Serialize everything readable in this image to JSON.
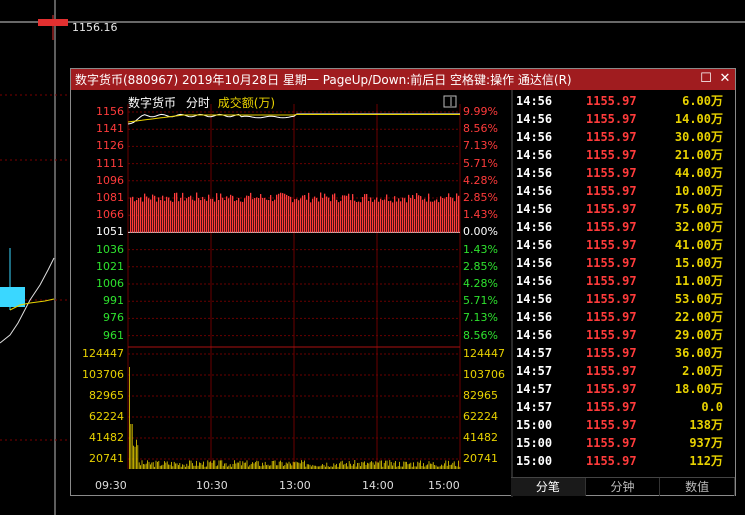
{
  "background_price": "1156.16",
  "window": {
    "title": "数字货币(880967) 2019年10月28日 星期一 PageUp/Down:前后日 空格键:操作 通达信(R)",
    "minimize_glyph": "☐",
    "close_glyph": "✕"
  },
  "chart_header": {
    "name": "数字货币",
    "mode": "分时",
    "metric": "成交额(万)"
  },
  "price_axis": {
    "left": [
      "1156",
      "1141",
      "1126",
      "1111",
      "1096",
      "1081",
      "1066",
      "1051",
      "1036",
      "1021",
      "1006",
      "991",
      "976",
      "961"
    ],
    "right": [
      "9.99%",
      "8.56%",
      "7.13%",
      "5.71%",
      "4.28%",
      "2.85%",
      "1.43%",
      "0.00%",
      "1.43%",
      "2.85%",
      "4.28%",
      "5.71%",
      "7.13%",
      "8.56%"
    ]
  },
  "volume_axis": {
    "left": [
      "124447",
      "103706",
      "82965",
      "62224",
      "41482",
      "20741"
    ],
    "right": [
      "124447",
      "103706",
      "82965",
      "62224",
      "41482",
      "20741"
    ]
  },
  "time_axis": [
    "09:30",
    "10:30",
    "13:00",
    "14:00",
    "15:00"
  ],
  "ticks": [
    {
      "time": "14:56",
      "price": "1155.97",
      "vol": "6.00",
      "unit": "万"
    },
    {
      "time": "14:56",
      "price": "1155.97",
      "vol": "14.00",
      "unit": "万"
    },
    {
      "time": "14:56",
      "price": "1155.97",
      "vol": "30.00",
      "unit": "万"
    },
    {
      "time": "14:56",
      "price": "1155.97",
      "vol": "21.00",
      "unit": "万"
    },
    {
      "time": "14:56",
      "price": "1155.97",
      "vol": "44.00",
      "unit": "万"
    },
    {
      "time": "14:56",
      "price": "1155.97",
      "vol": "10.00",
      "unit": "万"
    },
    {
      "time": "14:56",
      "price": "1155.97",
      "vol": "75.00",
      "unit": "万"
    },
    {
      "time": "14:56",
      "price": "1155.97",
      "vol": "32.00",
      "unit": "万"
    },
    {
      "time": "14:56",
      "price": "1155.97",
      "vol": "41.00",
      "unit": "万"
    },
    {
      "time": "14:56",
      "price": "1155.97",
      "vol": "15.00",
      "unit": "万"
    },
    {
      "time": "14:56",
      "price": "1155.97",
      "vol": "11.00",
      "unit": "万"
    },
    {
      "time": "14:56",
      "price": "1155.97",
      "vol": "53.00",
      "unit": "万"
    },
    {
      "time": "14:56",
      "price": "1155.97",
      "vol": "22.00",
      "unit": "万"
    },
    {
      "time": "14:56",
      "price": "1155.97",
      "vol": "29.00",
      "unit": "万"
    },
    {
      "time": "14:57",
      "price": "1155.97",
      "vol": "36.00",
      "unit": "万"
    },
    {
      "time": "14:57",
      "price": "1155.97",
      "vol": "2.00",
      "unit": "万"
    },
    {
      "time": "14:57",
      "price": "1155.97",
      "vol": "18.00",
      "unit": "万"
    },
    {
      "time": "14:57",
      "price": "1155.97",
      "vol": "0.0",
      "unit": ""
    },
    {
      "time": "15:00",
      "price": "1155.97",
      "vol": "138",
      "unit": "万"
    },
    {
      "time": "15:00",
      "price": "1155.97",
      "vol": "937",
      "unit": "万"
    },
    {
      "time": "15:00",
      "price": "1155.97",
      "vol": "112",
      "unit": "万"
    }
  ],
  "tabs": [
    {
      "label": "分笔",
      "active": true
    },
    {
      "label": "分钟",
      "active": false
    },
    {
      "label": "数值",
      "active": false
    }
  ],
  "colors": {
    "up": "#ff3b3b",
    "down": "#2ee22e",
    "volume": "#e8d200",
    "titlebar": "#a01c1f",
    "grid": "#6a0000"
  }
}
